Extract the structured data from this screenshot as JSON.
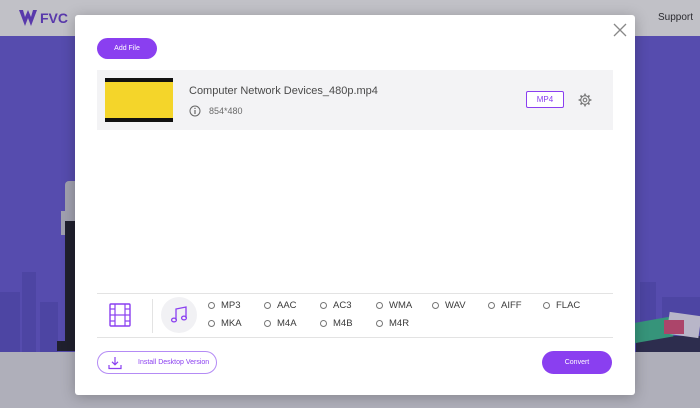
{
  "site": {
    "logo_text": "FVC",
    "nav_support": "Support",
    "brand_color": "#6a3fd1",
    "hero_color": "#6659d4"
  },
  "dialog": {
    "add_file_label": "Add File",
    "close_icon": "close-icon",
    "file": {
      "name": "Computer Network Devices_480p.mp4",
      "resolution": "854*480",
      "format": "MP4"
    },
    "tabs": {
      "video_icon": "film-icon",
      "audio_icon": "music-note-icon"
    },
    "audio_formats": [
      "MP3",
      "AAC",
      "AC3",
      "WMA",
      "WAV",
      "AIFF",
      "FLAC",
      "MKA",
      "M4A",
      "M4B",
      "M4R"
    ],
    "install_label": "Install Desktop Version",
    "convert_label": "Convert",
    "accent_color": "#8a3ff0"
  }
}
